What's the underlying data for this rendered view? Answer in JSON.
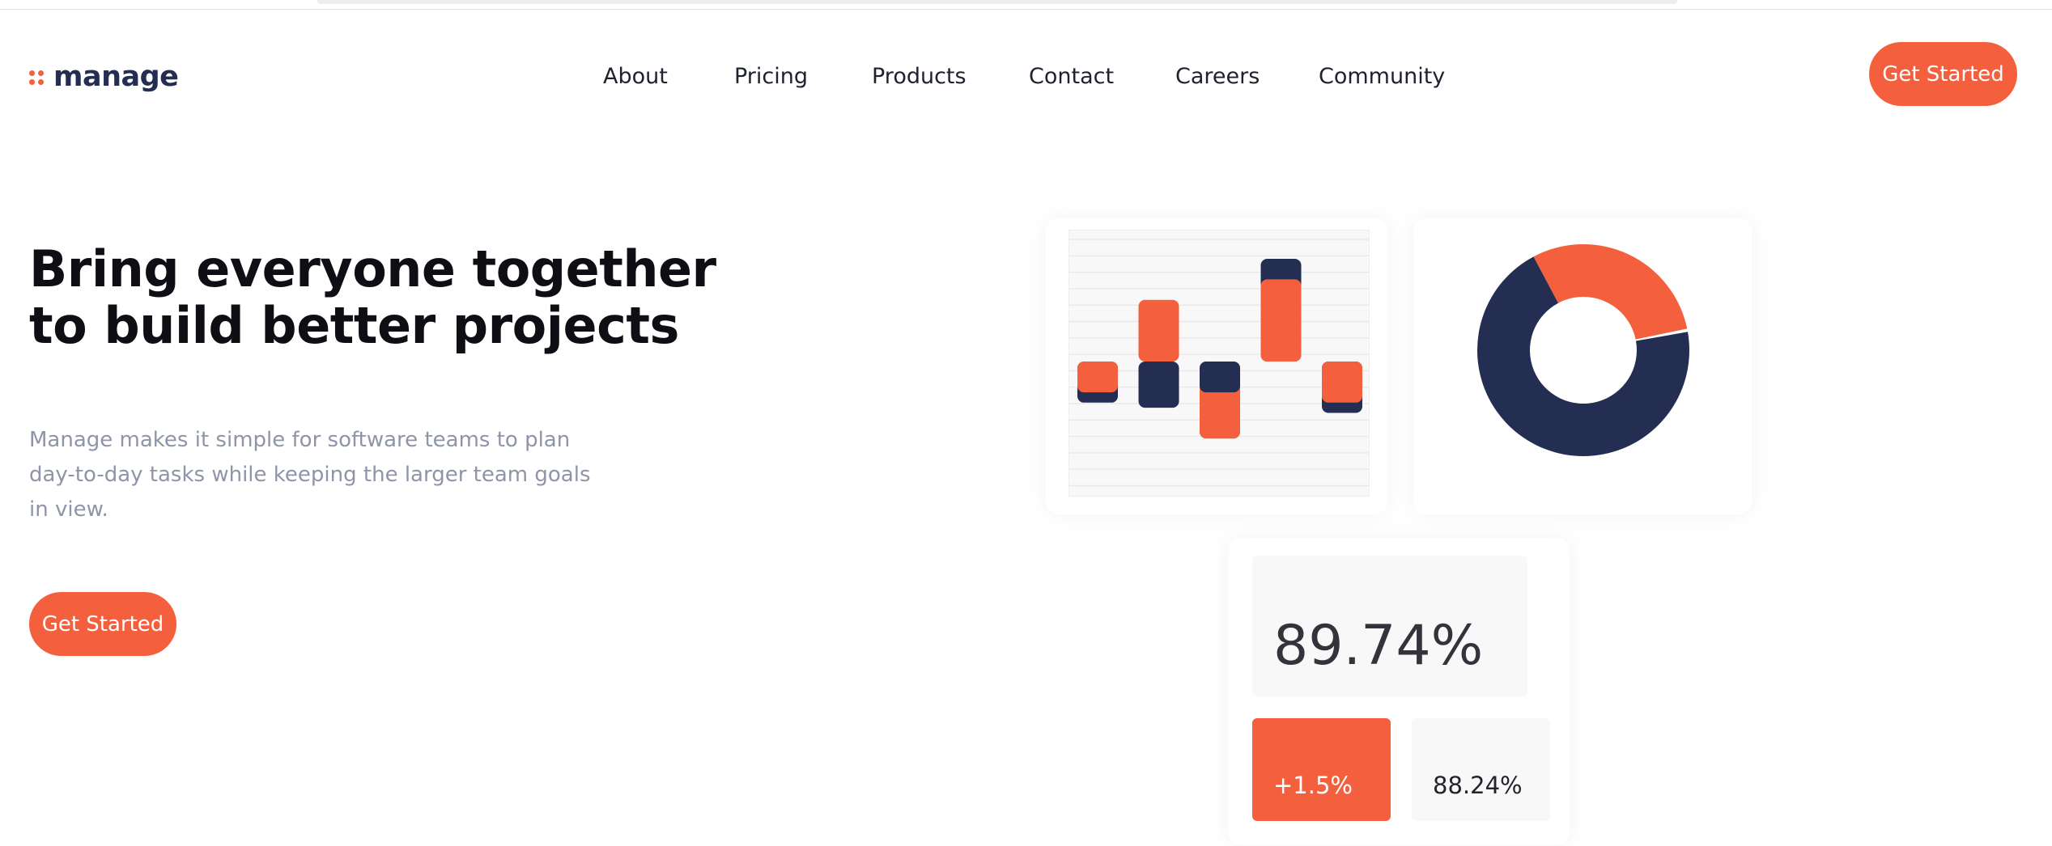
{
  "brand": {
    "name": "manage",
    "accent": "#f4603d",
    "dark": "#242d52"
  },
  "nav": {
    "items": [
      "About",
      "Pricing",
      "Products",
      "Contact",
      "Careers",
      "Community"
    ]
  },
  "header": {
    "cta_label": "Get Started"
  },
  "hero": {
    "title_lines": [
      "Bring everyone together",
      "to build better projects"
    ],
    "description_lines": [
      "Manage makes it simple for software teams to plan",
      "day-to-day tasks while keeping the larger team goals",
      "in view."
    ],
    "cta_label": "Get Started"
  },
  "bar_chart": {
    "type": "bar",
    "series": [
      {
        "color": "#f4603d",
        "values": [
          -3,
          6,
          -7.5,
          8,
          -4
        ]
      },
      {
        "color": "#242d52",
        "values": [
          -4,
          -4.5,
          -3,
          10,
          -5
        ]
      }
    ]
  },
  "donut_chart": {
    "type": "pie",
    "slices": [
      {
        "color": "#f4603d",
        "value": 0.3
      },
      {
        "color": "#242d52",
        "value": 0.7
      }
    ]
  },
  "stats": {
    "main": "89.74%",
    "change": "+1.5%",
    "secondary": "88.24%"
  }
}
